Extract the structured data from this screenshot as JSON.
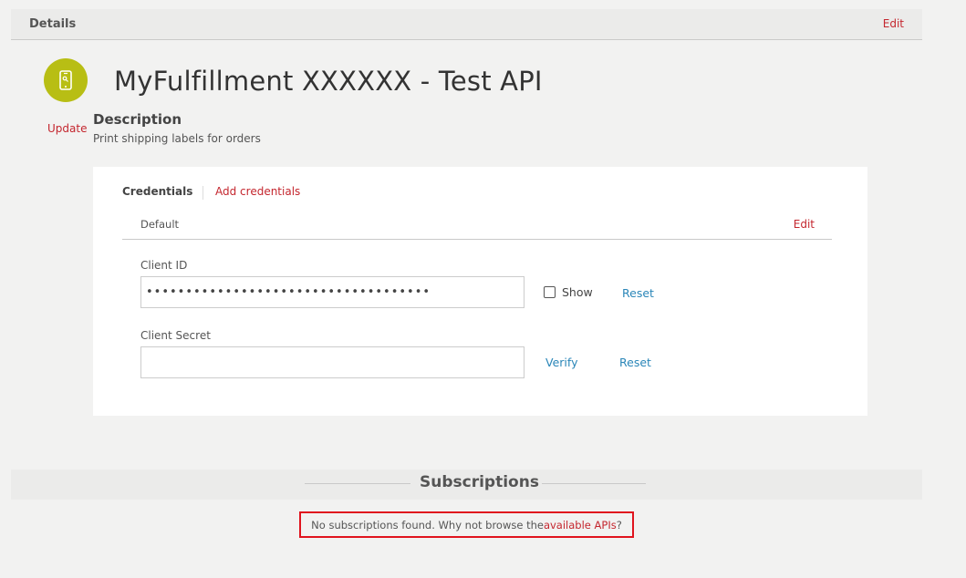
{
  "details": {
    "title": "Details",
    "edit_label": "Edit"
  },
  "app": {
    "title": "MyFulfillment XXXXXX - Test API",
    "update_label": "Update",
    "icon": "mobile-key-icon",
    "icon_color": "#b8be14"
  },
  "description": {
    "heading": "Description",
    "text": "Print shipping labels for orders"
  },
  "credentials": {
    "tab_label": "Credentials",
    "add_label": "Add credentials",
    "row_label": "Default",
    "row_edit_label": "Edit",
    "client_id": {
      "label": "Client ID",
      "value": "••••••••••••••••••••••••••••••••••••",
      "show_label": "Show",
      "show_checked": false,
      "reset_label": "Reset"
    },
    "client_secret": {
      "label": "Client Secret",
      "value": "",
      "verify_label": "Verify",
      "reset_label": "Reset"
    }
  },
  "subscriptions": {
    "title": "Subscriptions",
    "empty_text": "No subscriptions found. Why not browse the ",
    "link_label": "available APIs",
    "suffix": "?"
  },
  "colors": {
    "accent_red": "#c4262e",
    "link_blue": "#2a86b8",
    "highlight_border": "#e0141e"
  }
}
